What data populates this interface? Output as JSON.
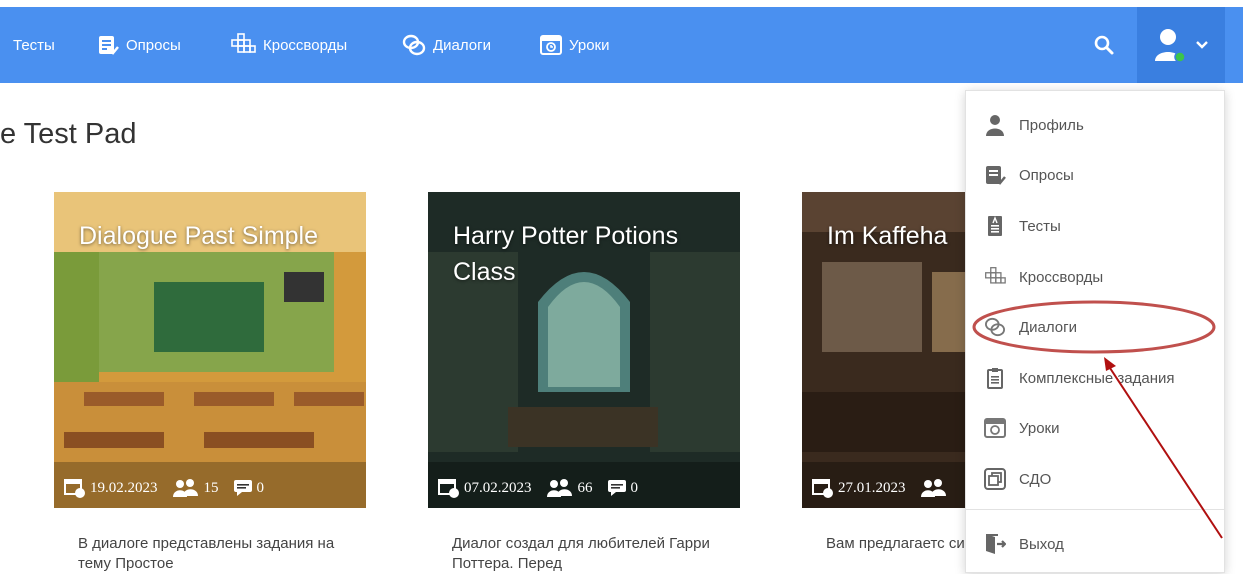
{
  "nav": {
    "items": [
      {
        "label": "Тесты",
        "icon": "test-icon"
      },
      {
        "label": "Опросы",
        "icon": "survey-icon"
      },
      {
        "label": "Кроссворды",
        "icon": "crossword-icon"
      },
      {
        "label": "Диалоги",
        "icon": "dialog-icon"
      },
      {
        "label": "Уроки",
        "icon": "lesson-icon"
      }
    ],
    "search_icon": "search-icon",
    "user_icon": "user-icon",
    "colors": {
      "bar": "#4a90f0",
      "user_box": "#3a7fe0",
      "online": "#3cc44a"
    }
  },
  "page": {
    "title": "e Test Pad"
  },
  "cards": [
    {
      "title": "Dialogue Past Simple",
      "date": "19.02.2023",
      "participants": "15",
      "comments": "0",
      "description": "В диалоге представлены задания на тему Простое"
    },
    {
      "title": "Harry Potter Potions Class",
      "date": "07.02.2023",
      "participants": "66",
      "comments": "0",
      "description": "Диалог создал для любителей Гарри Поттера. Перед"
    },
    {
      "title": "Im Kaffeha",
      "date": "27.01.2023",
      "participants": "",
      "comments": "",
      "description": "Вам предлагаетс ситуацию: Вы с г"
    }
  ],
  "dropdown": {
    "items": [
      {
        "label": "Профиль",
        "icon": "profile-icon"
      },
      {
        "label": "Опросы",
        "icon": "survey-icon"
      },
      {
        "label": "Тесты",
        "icon": "test-icon"
      },
      {
        "label": "Кроссворды",
        "icon": "crossword-icon"
      },
      {
        "label": "Диалоги",
        "icon": "dialog-icon",
        "highlighted": true
      },
      {
        "label": "Комплексные задания",
        "icon": "complex-task-icon"
      },
      {
        "label": "Уроки",
        "icon": "lesson-icon"
      },
      {
        "label": "СДО",
        "icon": "lms-icon"
      },
      {
        "label": "Выход",
        "icon": "logout-icon"
      }
    ]
  },
  "annotation": {
    "ellipse_color": "#c0504d",
    "arrow_color": "#b01010"
  }
}
